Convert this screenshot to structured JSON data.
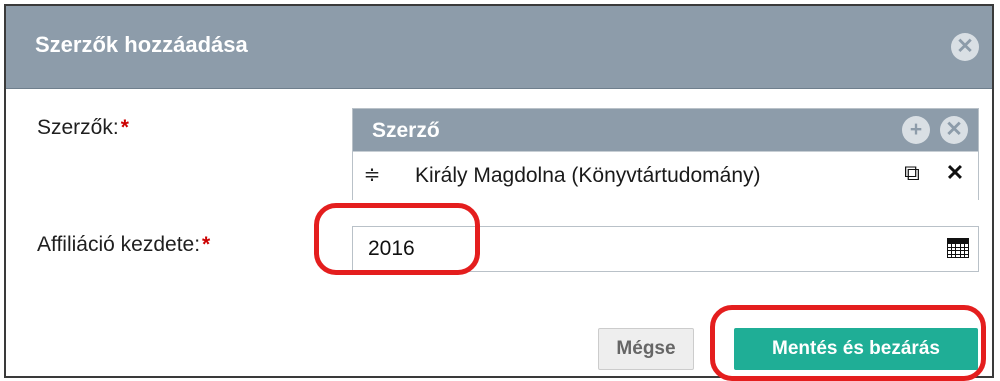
{
  "dialog": {
    "title": "Szerzők hozzáadása",
    "close_icon": "close-circle-icon"
  },
  "form": {
    "authors_label": "Szerzők:",
    "affiliation_label": "Affiliáció kezdete:",
    "required_mark": "*"
  },
  "authors_table": {
    "header": "Szerző",
    "add_icon": "plus-circle-icon",
    "remove_icon": "remove-circle-icon",
    "rows": [
      {
        "name": "Király Magdolna (Könyvtártudomány)"
      }
    ]
  },
  "affiliation_start": {
    "value": "2016",
    "calendar_icon": "calendar-icon"
  },
  "buttons": {
    "cancel": "Mégse",
    "save_close": "Mentés és bezárás"
  },
  "colors": {
    "header_bg": "#8d9caa",
    "primary_button": "#1fae96",
    "annotation": "#e41e1e",
    "required": "#cc0000"
  }
}
